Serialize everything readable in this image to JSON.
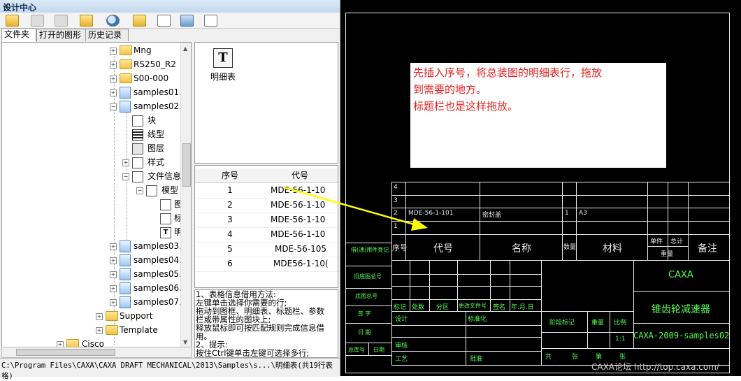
{
  "panel": {
    "title": "设计中心",
    "close": "×",
    "tabs": [
      "文件夹",
      "打开的图形",
      "历史记录"
    ]
  },
  "tree": [
    {
      "label": "Mng",
      "type": "folder"
    },
    {
      "label": "RS250_R2",
      "type": "folder"
    },
    {
      "label": "S00-000",
      "type": "folder"
    },
    {
      "label": "samples01.",
      "type": "drawing"
    },
    {
      "label": "samples02.",
      "type": "drawing"
    },
    {
      "label": "块",
      "type": "child"
    },
    {
      "label": "线型",
      "type": "child"
    },
    {
      "label": "图层",
      "type": "child"
    },
    {
      "label": "样式",
      "type": "child"
    },
    {
      "label": "文件信息",
      "type": "child"
    },
    {
      "label": "模型",
      "type": "child"
    },
    {
      "label": "图",
      "type": "leaf"
    },
    {
      "label": "标",
      "type": "leaf"
    },
    {
      "label": "明",
      "type": "leaf"
    },
    {
      "label": "samples03.",
      "type": "drawing"
    },
    {
      "label": "samples04.",
      "type": "drawing"
    },
    {
      "label": "samples05.",
      "type": "drawing"
    },
    {
      "label": "samples06.",
      "type": "drawing"
    },
    {
      "label": "samples07.",
      "type": "drawing"
    },
    {
      "label": "Support",
      "type": "folder"
    },
    {
      "label": "Template",
      "type": "folder"
    },
    {
      "label": "Cisco",
      "type": "folder"
    }
  ],
  "preview": {
    "icon_letter": "T",
    "label": "明细表"
  },
  "properties": {
    "headers": [
      "序号",
      "代号"
    ],
    "rows": [
      [
        "1",
        "MDE-56-1-10"
      ],
      [
        "2",
        "MDE-56-1-10"
      ],
      [
        "3",
        "MDE-56-1-10"
      ],
      [
        "4",
        "MDE-56-1-10"
      ],
      [
        "5",
        "MDE-56-105"
      ],
      [
        "6",
        "MDE56-1-10("
      ]
    ]
  },
  "description": [
    "1、表格信息借用方法:",
    "左键单击选择你需要的行;",
    "拖动到图框、明细表、标题栏、参数",
    "栏或带属性的图块上;",
    "释放鼠标即可按匹配规则完成信息借",
    "用。",
    "2、提示:",
    "按住Ctrl键单击左键可选择多行;"
  ],
  "status_text": "C:\\Program Files\\CAXA\\CAXA DRAFT MECHANICAL\\2013\\Samples\\s...\\明细表(共19行表格)",
  "note": [
    "先插入序号，将总装图的明细表行，拖放",
    "到需要的地方。",
    "标题栏也是这样拖放。"
  ],
  "drawing": {
    "row_numbers": [
      "4",
      "3",
      "2",
      "1"
    ],
    "row2": {
      "code": "MDE-56-1-101",
      "name": "密封盖",
      "qty": "1",
      "material": "A3"
    },
    "header": {
      "seq": "序号",
      "code": "代号",
      "name": "名称",
      "qty": "数量",
      "material": "材料",
      "unit": "单件",
      "total": "总计",
      "weight": "重量",
      "remark": "备注"
    },
    "left_strip": [
      "借(通)用件登记",
      "旧底图总号",
      "底图总号",
      "签 字",
      "日 期",
      "总库号",
      "日期"
    ],
    "title_block": {
      "company": "CAXA",
      "part_name": "锥齿轮减速器",
      "drawing_no": "CAXA-2009-samples02",
      "scale_value": "1:1",
      "labels": [
        "标记",
        "处数",
        "分区",
        "更改文件号",
        "签名",
        "年.月.日",
        "设计",
        "标准化",
        "阶段标记",
        "重量",
        "比例",
        "审核",
        "工艺",
        "批准",
        "共",
        "张",
        "第",
        "张"
      ]
    }
  },
  "watermark": "CAXA论坛 http://top.caxa.com/",
  "colors": {
    "note_text": "#e62020",
    "arrow": "#ffff00",
    "cad_background": "#000000",
    "cad_text_green": "#55ff55"
  }
}
